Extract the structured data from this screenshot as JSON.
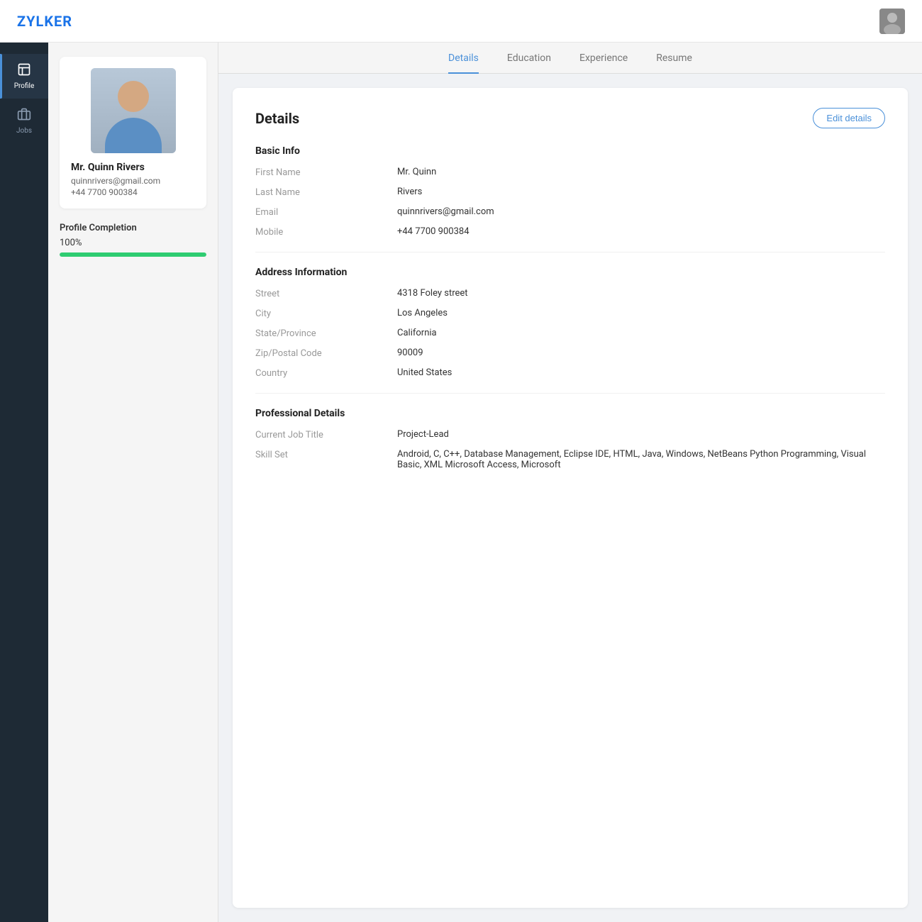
{
  "app": {
    "logo": "ZYLKER"
  },
  "sidebar": {
    "items": [
      {
        "id": "profile",
        "label": "Profile",
        "icon": "🗒",
        "active": true
      },
      {
        "id": "jobs",
        "label": "Jobs",
        "icon": "💼",
        "active": false
      }
    ]
  },
  "leftPanel": {
    "profilePhotoAlt": "Quinn Rivers photo",
    "name": "Mr. Quinn Rivers",
    "email": "quinnrivers@gmail.com",
    "phone": "+44 7700 900384",
    "completion": {
      "title": "Profile Completion",
      "percentage": "100%",
      "value": 100
    }
  },
  "tabs": [
    {
      "id": "details",
      "label": "Details",
      "active": true
    },
    {
      "id": "education",
      "label": "Education",
      "active": false
    },
    {
      "id": "experience",
      "label": "Experience",
      "active": false
    },
    {
      "id": "resume",
      "label": "Resume",
      "active": false
    }
  ],
  "details": {
    "title": "Details",
    "editButton": "Edit details",
    "basicInfo": {
      "sectionTitle": "Basic Info",
      "fields": [
        {
          "label": "First Name",
          "value": "Mr.   Quinn"
        },
        {
          "label": "Last Name",
          "value": "Rivers"
        },
        {
          "label": "Email",
          "value": "quinnrivers@gmail.com"
        },
        {
          "label": "Mobile",
          "value": "+44 7700 900384"
        }
      ]
    },
    "addressInfo": {
      "sectionTitle": "Address Information",
      "fields": [
        {
          "label": "Street",
          "value": "4318 Foley street"
        },
        {
          "label": "City",
          "value": "Los Angeles"
        },
        {
          "label": "State/Province",
          "value": "California"
        },
        {
          "label": "Zip/Postal Code",
          "value": "90009"
        },
        {
          "label": "Country",
          "value": "United States"
        }
      ]
    },
    "professionalDetails": {
      "sectionTitle": "Professional Details",
      "fields": [
        {
          "label": "Current Job Title",
          "value": "Project-Lead"
        },
        {
          "label": "Skill Set",
          "value": "Android, C, C++, Database Management, Eclipse IDE, HTML, Java, Windows, NetBeans Python Programming, Visual Basic, XML Microsoft Access, Microsoft"
        }
      ]
    }
  }
}
